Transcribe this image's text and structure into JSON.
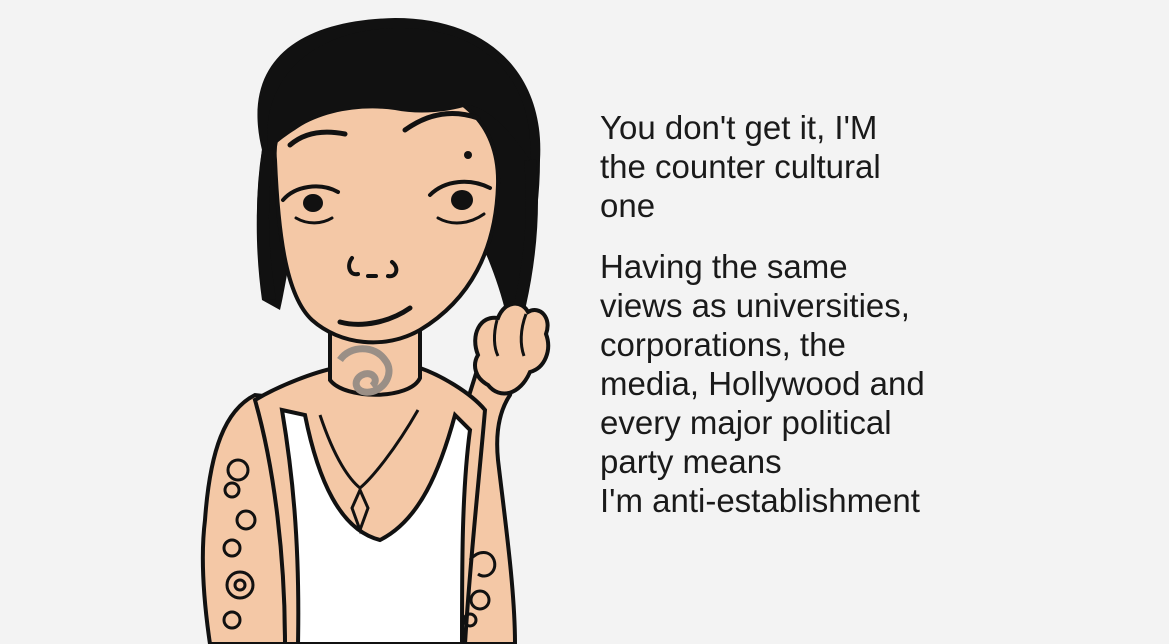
{
  "caption": {
    "line_1": "You don't get it, I'M\nthe counter cultural\none",
    "line_2": "Having the same\nviews as universities,\ncorporations, the\nmedia, Hollywood and\nevery major political\nparty means\nI'm anti-establishment"
  },
  "colors": {
    "background": "#f3f3f3",
    "skin": "#f4c8a6",
    "hair": "#111111",
    "ink": "#111111",
    "tank_top": "#ffffff",
    "neck_tattoo": "#9a8f86"
  },
  "figure": {
    "icon": "cartoon-person-illustration"
  }
}
